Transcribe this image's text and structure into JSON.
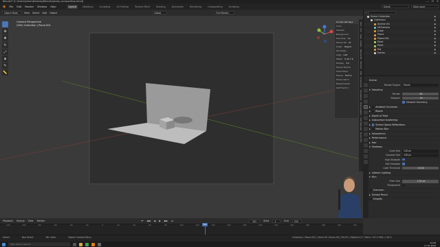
{
  "window": {
    "title": "Blender* [C:\\Users\\Anton\\Desktop\\Blender\\photo_compositing.blend]",
    "controls": [
      "—",
      "☐",
      "✕"
    ]
  },
  "menu": {
    "items": [
      "File",
      "Edit",
      "Render",
      "Window",
      "Help"
    ],
    "workspaces": [
      "Layout",
      "Modeling",
      "Sculpting",
      "UV Editing",
      "Texture Paint",
      "Shading",
      "Animation",
      "Rendering",
      "Compositing",
      "Scripting"
    ],
    "active_workspace": "Layout",
    "scene_label": "Scene",
    "view_layer": "View Layer"
  },
  "viewport_header": {
    "mode": "Object Mode",
    "menus": [
      "View",
      "Select",
      "Add",
      "Object"
    ],
    "transform": "Global",
    "snap": "Find Models"
  },
  "viewport": {
    "camera_label": "Camera Perspective",
    "collection_label": "(302) Collection | Plane.001"
  },
  "npanel": {
    "header": "Screencast Keys",
    "rows": [
      "Color",
      "Shadow",
      "Background",
      "Font Size",
      "Mouse Siz",
      "Origin",
      "Set Origin",
      "Align",
      "Offset",
      "Display",
      "Mouse Events",
      "Show Mous",
      "Mouse",
      "Show Last O",
      "Experimental",
      "Get Event A"
    ],
    "values": [
      "",
      "",
      "",
      "14",
      "21",
      "Region",
      "",
      "Left",
      "X 20 Y 8",
      "3.0",
      "",
      "",
      "Hold S.",
      "",
      "",
      ""
    ],
    "tabs": [
      "Item",
      "Tool",
      "View",
      "Create",
      "BlenderKit",
      "3D-Print",
      "Edit",
      "Screencast",
      "Vacatatoss",
      "Photographer",
      "Shot Manager",
      "Quick VFX"
    ]
  },
  "outliner": {
    "title": "Scene Collection",
    "rows": [
      {
        "name": "Scene Collection",
        "color": "#cccccc",
        "indent": 0
      },
      {
        "name": "Collection",
        "color": "#cccccc",
        "indent": 1
      },
      {
        "name": "Anchor #1",
        "color": "#e39c3b",
        "indent": 2
      },
      {
        "name": "HECamera",
        "color": "#6fc0c7",
        "indent": 2
      },
      {
        "name": "Cube",
        "color": "#e39c3b",
        "indent": 2
      },
      {
        "name": "Plane",
        "color": "#e39c3b",
        "indent": 2
      },
      {
        "name": "Plane.001",
        "color": "#e39c3b",
        "indent": 2
      },
      {
        "name": "Point",
        "color": "#a9d26b",
        "indent": 2
      },
      {
        "name": "Point",
        "color": "#a9d26b",
        "indent": 2
      },
      {
        "name": "Pot",
        "color": "#e39c3b",
        "indent": 2
      },
      {
        "name": "Extras",
        "color": "#cccccc",
        "indent": 2
      }
    ]
  },
  "properties": {
    "title": "Scene",
    "render_engine": {
      "label": "Render Engine",
      "value": "Eevee"
    },
    "sampling": "Sampling",
    "render": {
      "label": "Render",
      "value": "64"
    },
    "viewport": {
      "label": "Viewport",
      "value": "16"
    },
    "viewport_denoising": "Viewport Denoising",
    "sections": [
      {
        "label": "Ambient Occlusion",
        "checkbox": true,
        "on": false
      },
      {
        "label": "Bloom",
        "checkbox": true,
        "on": false
      },
      {
        "label": "Depth of Field",
        "checkbox": false,
        "on": false
      },
      {
        "label": "Subsurface Scattering",
        "checkbox": false,
        "on": false
      },
      {
        "label": "Screen Space Reflections",
        "checkbox": true,
        "on": true
      },
      {
        "label": "Motion Blur",
        "checkbox": true,
        "on": false
      },
      {
        "label": "Volumetrics",
        "checkbox": false,
        "on": false
      },
      {
        "label": "Performance",
        "checkbox": false,
        "on": false
      },
      {
        "label": "Hair",
        "checkbox": false,
        "on": false
      },
      {
        "label": "Shadows",
        "checkbox": false,
        "on": false
      }
    ],
    "cube_size": {
      "label": "Cube Size",
      "value": "128 px"
    },
    "cascade_size": {
      "label": "Cascade Size",
      "value": "128 px"
    },
    "high_bitdepth": "High Bitdepth",
    "soft_shadows": "Soft Shadows",
    "light_threshold": {
      "label": "Light Threshold",
      "value": "0.010"
    },
    "indirect_lighting": "Indirect Lighting",
    "film": "Film",
    "filter_size": {
      "label": "Filter Size",
      "value": "1.50 px"
    },
    "transparent": "Transparent",
    "overscan": "Overscan",
    "grease_pencil": "Grease Pencil",
    "simplify": "Simplify"
  },
  "timeline": {
    "menus": [
      "Playback",
      "Keying",
      "View",
      "Marker"
    ],
    "start_label": "Start",
    "start": "1",
    "end_label": "End",
    "end": "250",
    "current_frame": "302",
    "ticks": [
      "-120",
      "-100",
      "-80",
      "-60",
      "-40",
      "-20",
      "0",
      "20",
      "40",
      "60",
      "80",
      "100",
      "120",
      "140",
      "160",
      "180",
      "200",
      "220",
      "240",
      "260",
      "280",
      "300",
      "320"
    ]
  },
  "status": {
    "hints": [
      "Select",
      "Box Select",
      "Pan View",
      "Object Context Menu"
    ],
    "stats": "Collection | Plane.001 | Verts:30 | Faces:28 | Tris:52 | Objects:1/7 | Mem: 107.5 MiB | 2.82.2"
  },
  "taskbar": {
    "search_placeholder": "Type here to search",
    "time": "12:06",
    "date": "17.07.2020"
  }
}
